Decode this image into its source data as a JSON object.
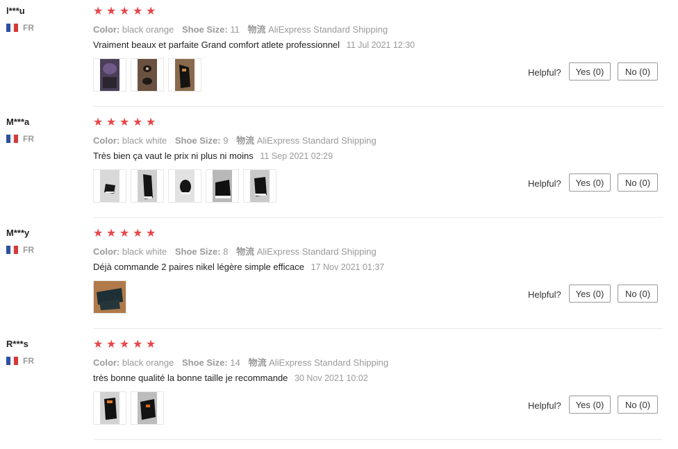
{
  "labels": {
    "color": "Color:",
    "shoe_size": "Shoe Size:",
    "logistics": "物流",
    "helpful": "Helpful?"
  },
  "rating_stars": "★★★★★",
  "flag_colors": [
    "#2d50a0",
    "#ffffff",
    "#d33a3a"
  ],
  "reviews": [
    {
      "user": "l***u",
      "country": "FR",
      "rating": 5,
      "color": "black orange",
      "shoe_size": "11",
      "shipping": "AliExpress Standard Shipping",
      "text": "Vraiment beaux et parfaite Grand comfort atlete professionnel",
      "date": "11 Jul 2021 12:30",
      "photos": [
        "shoe-photo-purple",
        "shoe-photo-brown",
        "shoe-photo-dark"
      ],
      "yes": "Yes (0)",
      "no": "No (0)"
    },
    {
      "user": "M***a",
      "country": "FR",
      "rating": 5,
      "color": "black white",
      "shoe_size": "9",
      "shipping": "AliExpress Standard Shipping",
      "text": "Très bien ça vaut le prix ni plus ni moins",
      "date": "11 Sep 2021 02:29",
      "photos": [
        "shoe-photo-1",
        "shoe-photo-2",
        "shoe-photo-3",
        "shoe-photo-4",
        "shoe-photo-5"
      ],
      "yes": "Yes (0)",
      "no": "No (0)"
    },
    {
      "user": "M***y",
      "country": "FR",
      "rating": 5,
      "color": "black white",
      "shoe_size": "8",
      "shipping": "AliExpress Standard Shipping",
      "text": "Déjà commande 2 paires nikel légère simple efficace",
      "date": "17 Nov 2021 01:37",
      "photos": [
        "shoe-photo-1"
      ],
      "yes": "Yes (0)",
      "no": "No (0)"
    },
    {
      "user": "R***s",
      "country": "FR",
      "rating": 5,
      "color": "black orange",
      "shoe_size": "14",
      "shipping": "AliExpress Standard Shipping",
      "text": "très bonne qualité la bonne taille je recommande",
      "date": "30 Nov 2021 10:02",
      "photos": [
        "shoe-photo-1",
        "shoe-photo-2"
      ],
      "yes": "Yes (0)",
      "no": "No (0)"
    }
  ]
}
